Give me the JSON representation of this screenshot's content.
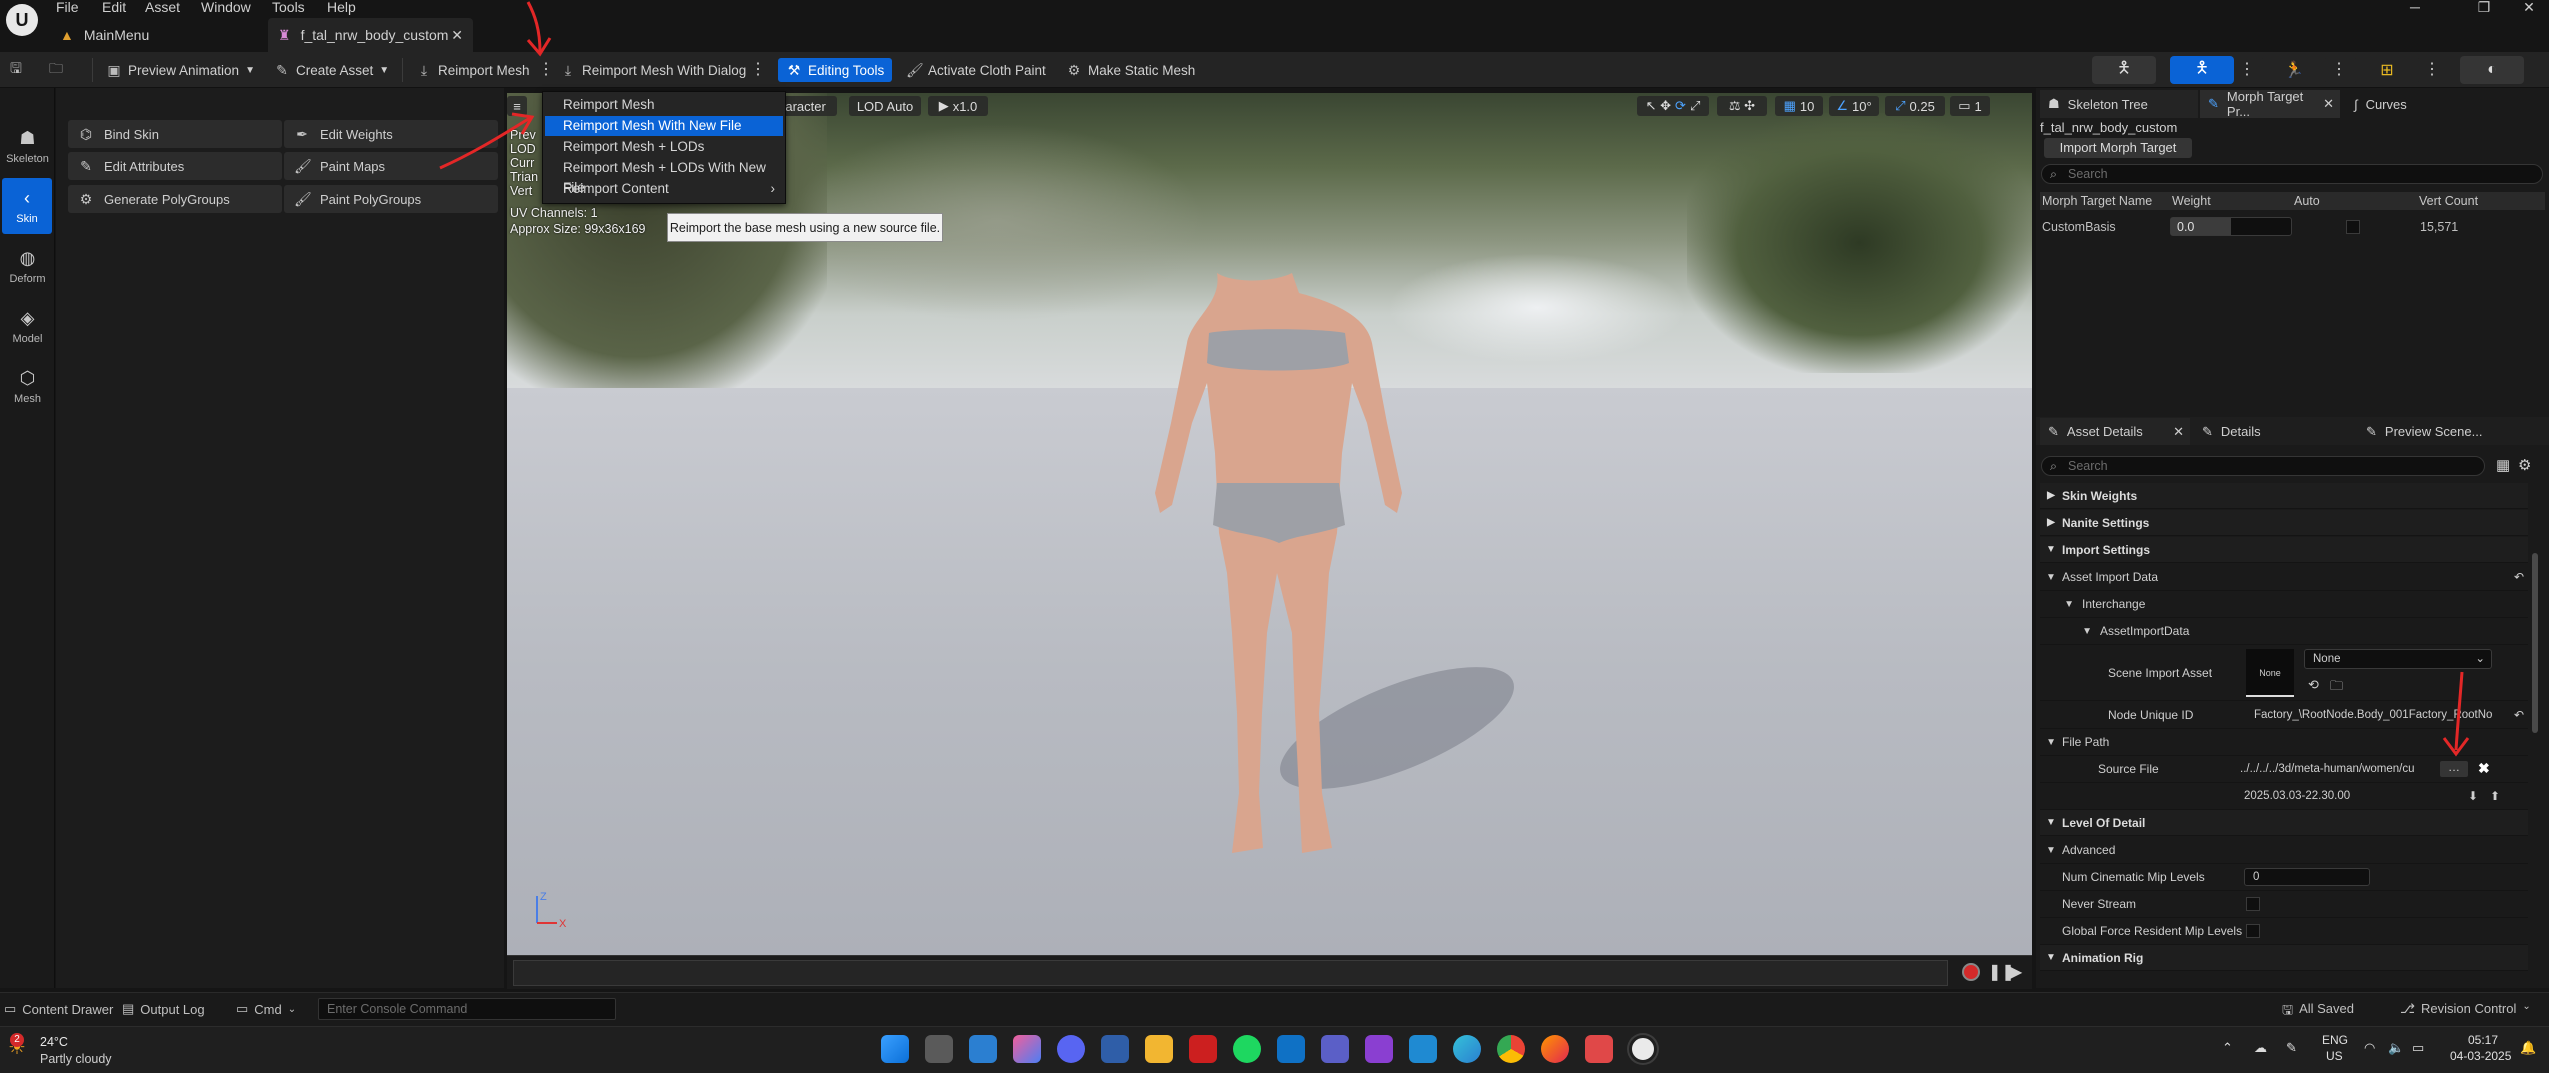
{
  "menubar": {
    "items": [
      "File",
      "Edit",
      "Asset",
      "Window",
      "Tools",
      "Help"
    ],
    "tabs": [
      {
        "label": "MainMenu"
      },
      {
        "label": "f_tal_nrw_body_custom"
      }
    ]
  },
  "toolbar": {
    "preview_animation": "Preview Animation",
    "create_asset": "Create Asset",
    "reimport_mesh": "Reimport Mesh",
    "reimport_with_dialog": "Reimport Mesh With Dialog",
    "editing_tools": "Editing Tools",
    "activate_cloth_paint": "Activate Cloth Paint",
    "make_static_mesh": "Make Static Mesh"
  },
  "modes": [
    {
      "label": "Skeleton",
      "icon": "skeleton-icon"
    },
    {
      "label": "Skin",
      "icon": "chevron-left-icon"
    },
    {
      "label": "Deform",
      "icon": "deform-icon"
    },
    {
      "label": "Model",
      "icon": "model-icon"
    },
    {
      "label": "Mesh",
      "icon": "mesh-icon"
    }
  ],
  "tools": [
    {
      "label": "Bind Skin"
    },
    {
      "label": "Edit Weights"
    },
    {
      "label": "Edit Attributes"
    },
    {
      "label": "Paint Maps"
    },
    {
      "label": "Generate PolyGroups"
    },
    {
      "label": "Paint PolyGroups"
    }
  ],
  "viewport": {
    "character_btn": "haracter",
    "lod_btn": "LOD Auto",
    "play_btn": "x1.0",
    "grid_size": "10",
    "rotation_snap": "10°",
    "scale_snap": "0.25",
    "camera_speed": "1",
    "info_lines": [
      "Prev",
      "LOD",
      "Curr",
      "Trian",
      "Vert"
    ],
    "uv_channels": "UV Channels: 1",
    "approx_size": "Approx Size: 99x36x169"
  },
  "dropdown": {
    "items": [
      {
        "label": "Reimport Mesh"
      },
      {
        "label": "Reimport Mesh With New File"
      },
      {
        "label": "Reimport Mesh + LODs"
      },
      {
        "label": "Reimport Mesh + LODs With New File"
      },
      {
        "label": "Reimport Content"
      }
    ],
    "selected_index": 1
  },
  "tooltip": "Reimport the base mesh using a new source file.",
  "right_top": {
    "tabs": [
      "Skeleton Tree",
      "Morph Target Pr...",
      "Curves"
    ],
    "asset_name": "f_tal_nrw_body_custom",
    "import_btn": "Import Morph Target",
    "search_placeholder": "Search",
    "columns": [
      "Morph Target Name",
      "Weight",
      "Auto",
      "Vert Count"
    ],
    "row": {
      "name": "CustomBasis",
      "weight": "0.0",
      "vert_count": "15,571"
    }
  },
  "right_bottom": {
    "tabs": [
      "Asset Details",
      "Details",
      "Preview Scene..."
    ],
    "search_placeholder": "Search",
    "categories": {
      "skin_weights": "Skin Weights",
      "nanite": "Nanite Settings",
      "import": "Import Settings",
      "asset_import_data": "Asset Import Data",
      "interchange": "Interchange",
      "asset_import_data2": "AssetImportData",
      "file_path": "File Path",
      "lod": "Level Of Detail",
      "advanced": "Advanced",
      "anim_rig": "Animation Rig"
    },
    "props": {
      "scene_import_asset": "Scene Import Asset",
      "scene_import_none_thumb": "None",
      "scene_import_value": "None",
      "node_unique_id": "Node Unique ID",
      "node_unique_value": "Factory_\\RootNode.Body_001Factory_RootNo",
      "source_file": "Source File",
      "source_file_value": "../../../../3d/meta-human/women/cu",
      "source_file_date": "2025.03.03-22.30.00",
      "num_cine_mip": "Num Cinematic Mip Levels",
      "num_cine_mip_value": "0",
      "never_stream": "Never Stream",
      "global_force": "Global Force Resident Mip Levels"
    }
  },
  "statusbar": {
    "content_drawer": "Content Drawer",
    "output_log": "Output Log",
    "cmd": "Cmd",
    "console_placeholder": "Enter Console Command",
    "all_saved": "All Saved",
    "revision_control": "Revision Control"
  },
  "taskbar": {
    "temp": "24°C",
    "weather": "Partly cloudy",
    "lang": "ENG",
    "region": "US",
    "time": "05:17",
    "date": "04-03-2025",
    "badge": "2"
  }
}
